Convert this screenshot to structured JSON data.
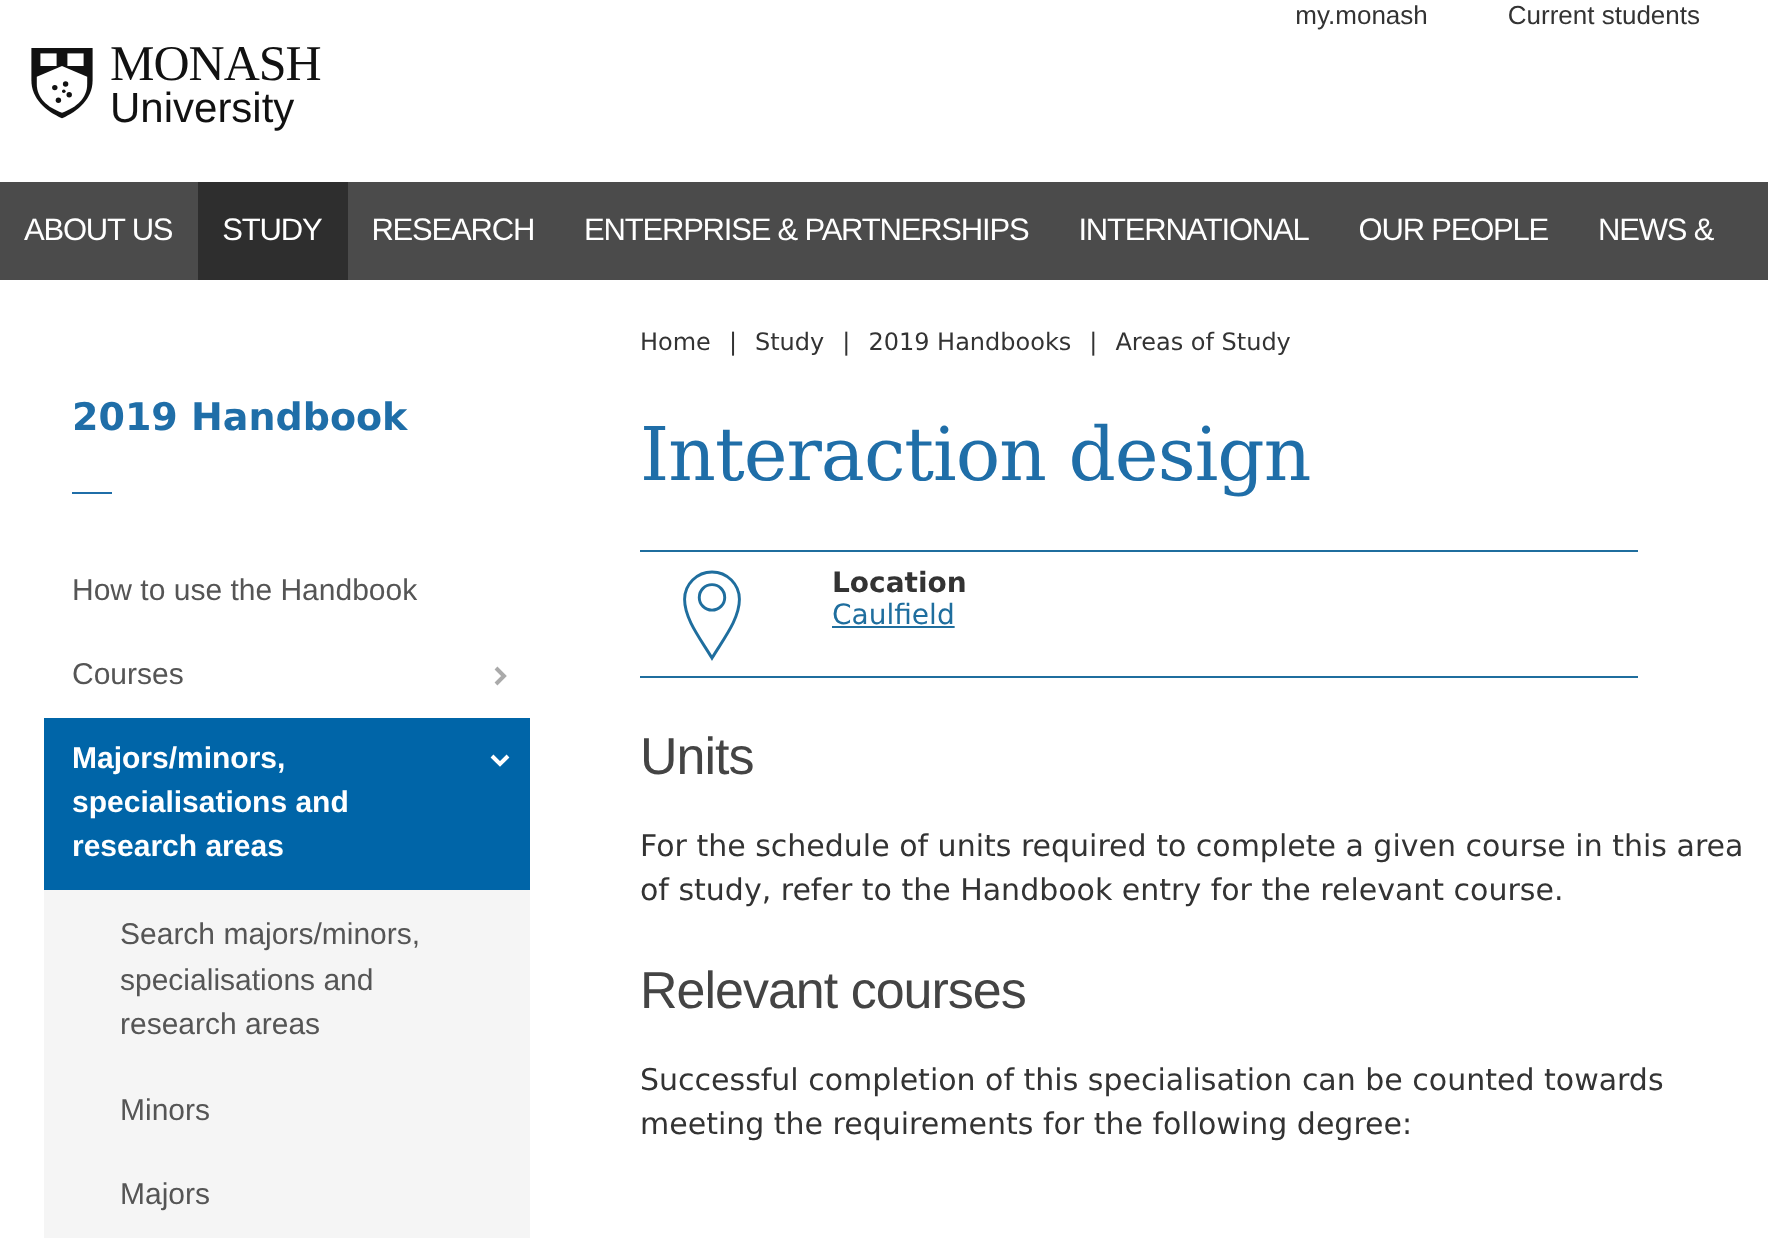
{
  "logo": {
    "name": "MONASH",
    "subtitle": "University"
  },
  "top_links": [
    "my.monash",
    "Current students"
  ],
  "nav": [
    {
      "label": "ABOUT US",
      "selected": false
    },
    {
      "label": "STUDY",
      "selected": true
    },
    {
      "label": "RESEARCH",
      "selected": false
    },
    {
      "label": "ENTERPRISE & PARTNERSHIPS",
      "selected": false
    },
    {
      "label": "INTERNATIONAL",
      "selected": false
    },
    {
      "label": "OUR PEOPLE",
      "selected": false
    },
    {
      "label": "NEWS &",
      "selected": false
    }
  ],
  "sidebar": {
    "title": "2019 Handbook",
    "items": [
      {
        "label": "How to use the Handbook",
        "kind": "link",
        "selected": false
      },
      {
        "label": "Courses",
        "kind": "menu",
        "selected": false,
        "expanded": false
      },
      {
        "label": "Majors/minors, specialisations and research areas",
        "kind": "menu",
        "selected": true,
        "expanded": true,
        "children": [
          {
            "label": "Search majors/minors, specialisations and research areas"
          },
          {
            "label": "Minors"
          },
          {
            "label": "Majors"
          }
        ]
      }
    ]
  },
  "breadcrumbs": [
    "Home",
    "Study",
    "2019 Handbooks",
    "Areas of Study"
  ],
  "breadcrumb_separator": "|",
  "title": "Interaction design",
  "location": {
    "label": "Location",
    "value": "Caulfield"
  },
  "sections": [
    {
      "heading": "Units",
      "text": "For the schedule of units required to complete a given course in this area of study, refer to the Handbook entry for the relevant course."
    },
    {
      "heading": "Relevant courses",
      "text": "Successful completion of this specialisation can be counted towards meeting the requirements for the following degree:"
    }
  ]
}
